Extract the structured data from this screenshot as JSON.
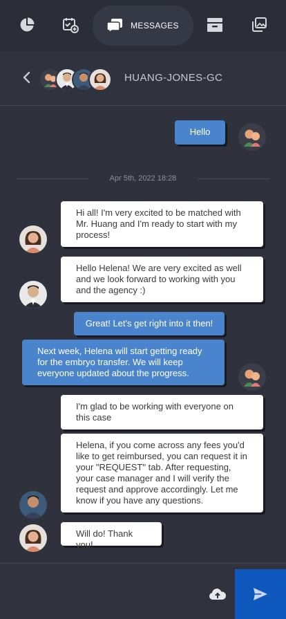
{
  "nav": {
    "items": [
      {
        "icon": "pie-chart-icon"
      },
      {
        "icon": "calendar-add-icon"
      },
      {
        "icon": "messages-icon",
        "label": "MESSAGES"
      },
      {
        "icon": "inbox-icon"
      },
      {
        "icon": "gallery-icon"
      }
    ]
  },
  "header": {
    "title": "HUANG-JONES-GC"
  },
  "chat": {
    "date_divider": "Apr 5th, 2022 18:28",
    "messages": [
      {
        "text": "Hello"
      },
      {
        "text": "Hi all! I'm very excited to be matched with Mr. Huang and I'm ready to start with my process!"
      },
      {
        "text": "Hello Helena! We are very excited as well and we look forward to working with you and the agency :)"
      },
      {
        "text": "Great! Let's get right into it then!"
      },
      {
        "text": "Next week, Helena will start getting ready for the embryo transfer. We will keep everyone updated about the progress."
      },
      {
        "text": "I'm glad to be working with everyone on this case"
      },
      {
        "text": "Helena, if you come across any fees you'd like to get reimbursed, you can request it in your \"REQUEST\" tab. After requesting, your case manager and I will verify the request and approve accordingly. Let me know if you have any questions."
      },
      {
        "text": "Will do! Thank you!"
      }
    ]
  },
  "composer": {
    "placeholder": ""
  },
  "colors": {
    "background": "#2f313c",
    "accent": "#0e57bd",
    "bubble_blue": "#4a84cc"
  }
}
